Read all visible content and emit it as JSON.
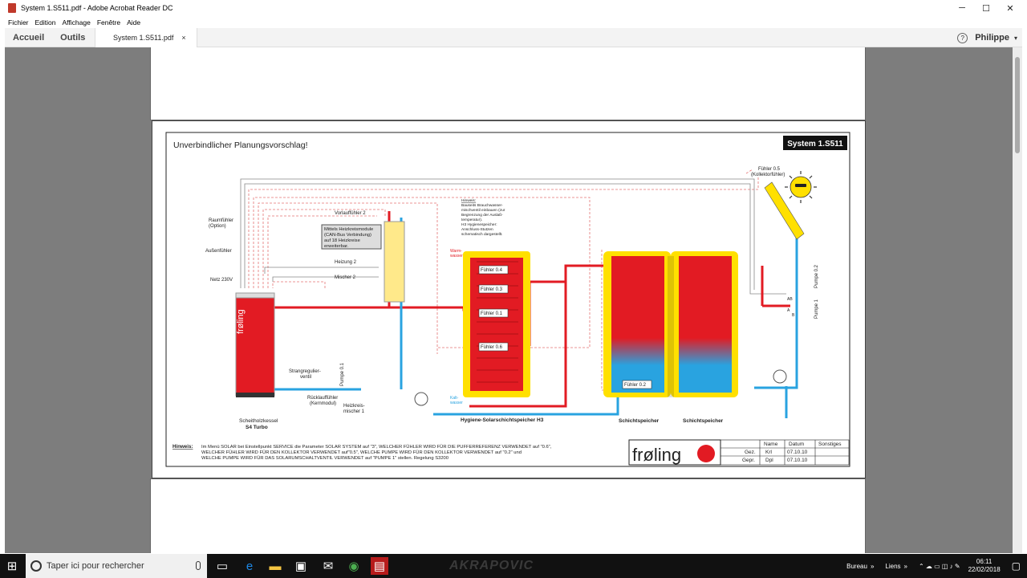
{
  "window": {
    "title": "System 1.S511.pdf - Adobe Acrobat Reader DC",
    "minimize": "─",
    "maximize": "☐",
    "close": "✕"
  },
  "menu": [
    "Fichier",
    "Edition",
    "Affichage",
    "Fenêtre",
    "Aide"
  ],
  "toolbar": {
    "home": "Accueil",
    "tools": "Outils",
    "doc_tab": "System 1.S511.pdf",
    "close_tab": "×",
    "help": "?",
    "user": "Philippe",
    "user_caret": "▾"
  },
  "drawing": {
    "heading": "Unverbindlicher Planungsvorschlag!",
    "system_badge": "System 1.S511",
    "labels": {
      "raumfuehler1": "Raumfühler",
      "raumfuehler2": "(Option)",
      "aussenfuehler": "Außenfühler",
      "netz": "Netz 230V",
      "vorlauf": "Vorlauffühler 2",
      "module1": "Mittels Heizkreismodule",
      "module2": "(CAN-Bus Verbindung)",
      "module3": "auf 18 Heizkreise",
      "module4": "erweiterbar.",
      "heizung2": "Heizung 2",
      "mischer2": "Mischer 2",
      "pumpe01": "Pumpe 0.1",
      "strang1": "Strangregulier-",
      "strang2": "ventil",
      "rueck1": "Rücklauffühler",
      "rueck2": "(Kernmodul)",
      "hkm1": "Heizkreis-",
      "hkm2": "mischer 1",
      "kessel1": "Scheitholzkessel",
      "kessel2": "S4 Turbo",
      "hinweis_box1": "Hinweis:",
      "hinweis_box2": "Bauseits Brauchwasser-",
      "hinweis_box3": "mischventil einbauen (zur",
      "hinweis_box4": "Begrenzung der Auslaß-",
      "hinweis_box5": "temperatur).",
      "hinweis_box6": "H3 Hygienespeicher:",
      "hinweis_box7": "Anschluss-Stutzen",
      "hinweis_box8": "schematisch dargestellt.",
      "warm1": "Warm-",
      "warm2": "wasser",
      "kalt1": "Kalt-",
      "kalt2": "wasser",
      "f04": "Fühler 0.4",
      "f03": "Fühler 0.3",
      "f01": "Fühler 0.1",
      "f06": "Fühler 0.6",
      "f02": "Fühler 0.2",
      "f05a": "Fühler 0.5",
      "f05b": "(Kollektorfühler)",
      "hygiene": "Hygiene-Solarschichtspeicher H3",
      "schicht1": "Schichtspeicher",
      "schicht2": "Schichtspeicher",
      "pumpe02": "Pumpe 0.2",
      "pumpe1": "Pumpe 1",
      "ab": "AB",
      "a": "A",
      "b": "B",
      "logo": "frøling"
    },
    "note_label": "Hinweis:",
    "note_lines": [
      "Im Menü SOLAR bei Einstellpunkt SERVICE die Parameter SOLAR SYSTEM auf \"3\", WELCHER FÜHLER WIRD FÜR DIE PUFFERREFERENZ VERWENDET auf \"0.6\",",
      "WELCHER FÜHLER WIRD FÜR DEN KOLLEKTOR VERWENDET auf\"0.5\", WELCHE PUMPE WIRD FÜR DEN KOLLEKTOR VERWENDET auf \"0.2\" und",
      "WELCHE PUMPE WIRD FÜR DAS SOLARUMSCHALTVENTIL VERWENDET auf \"PUMPE 1\" stellen. Regelung S3200"
    ],
    "table": {
      "headers": [
        "Name",
        "Datum",
        "Sonstiges"
      ],
      "rows": [
        {
          "label": "Gez.",
          "name": "Krl",
          "date": "07.10.10",
          "other": ""
        },
        {
          "label": "Gepr.",
          "name": "Dpl",
          "date": "07.10.10",
          "other": ""
        }
      ]
    }
  },
  "taskbar": {
    "search_placeholder": "Taper ici pour rechercher",
    "brand": "AKRAPOVIC",
    "bureau": "Bureau",
    "liens": "Liens",
    "time": "06:11",
    "date": "22/02/2018"
  }
}
